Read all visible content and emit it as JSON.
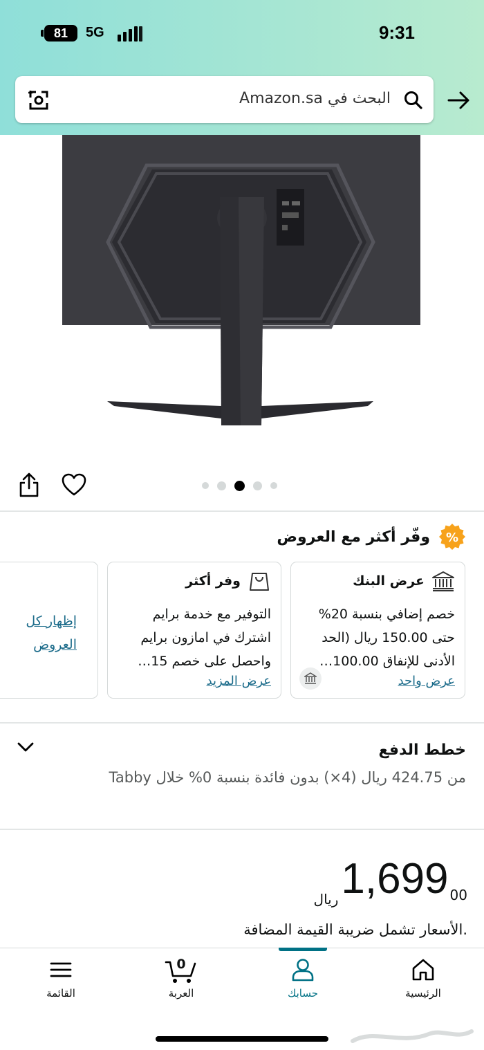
{
  "status_bar": {
    "time": "9:31",
    "battery": "81",
    "network": "5G"
  },
  "search": {
    "placeholder": "البحث في Amazon.sa"
  },
  "gallery": {
    "total": 5,
    "active_index": 2
  },
  "offers": {
    "title": "وفّر أكثر مع العروض",
    "cards": [
      {
        "title": "عرض البنك",
        "text": "خصم إضافي بنسبة 20% حتى 150.00 ريال (الحد الأدنى للإنفاق 100.00…",
        "link": "عرض واحد",
        "icon": "bank-icon"
      },
      {
        "title": "وفر أكثر",
        "text": "التوفير مع خدمة برايم اشترك في امازون برايم واحصل على خصم 15…",
        "link": "عرض المزيد",
        "icon": "shopping-bag-icon"
      }
    ],
    "show_all": "إظهار كل العروض"
  },
  "payment": {
    "title": "خطط الدفع",
    "text": "من 424.75 ريال (4×) بدون فائدة بنسبة 0% خلال Tabby"
  },
  "price": {
    "currency": "ريال",
    "whole": "1,699",
    "fraction": "00"
  },
  "vat_note": ".الأسعار تشمل ضريبة القيمة المضافة",
  "nav": {
    "home": "الرئيسية",
    "account": "حسابك",
    "cart": "العربة",
    "cart_count": "0",
    "menu": "القائمة"
  },
  "colors": {
    "accent": "#007185",
    "link": "#1b6b8a",
    "offer_badge": "#f7a21b"
  }
}
